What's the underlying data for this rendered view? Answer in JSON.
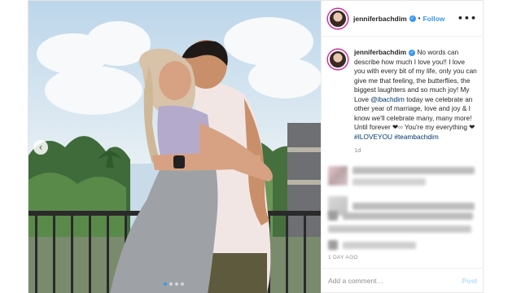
{
  "post": {
    "username": "jenniferbachdim",
    "follow_label": "Follow",
    "separator": "•",
    "more_icon": "more-horizontal-icon",
    "caption_text": "No words can describe how much I love you!! I love you with every bit of my life, only you can give me that feeling, the butterflies, the biggest laughters and so much joy! My Love ",
    "mention": "@ibachdim",
    "caption_text_2": " today we celebrate an other year of marriage, love and joy & I know we'll celebrate many, many more! Until forever ❤▫▫ You're my everything ❤ ",
    "hashtags": "#ILOVEYOU #teambachdim",
    "relative_time": "1d",
    "date_label": "1 DAY AGO",
    "add_comment_placeholder": "Add a comment…",
    "post_button_label": "Post"
  },
  "carousel": {
    "total_slides": 4,
    "active_slide": 1
  },
  "colors": {
    "link_blue": "#3897f0",
    "post_button_disabled": "#b2dffc",
    "muted_text": "#8e8e8e"
  }
}
